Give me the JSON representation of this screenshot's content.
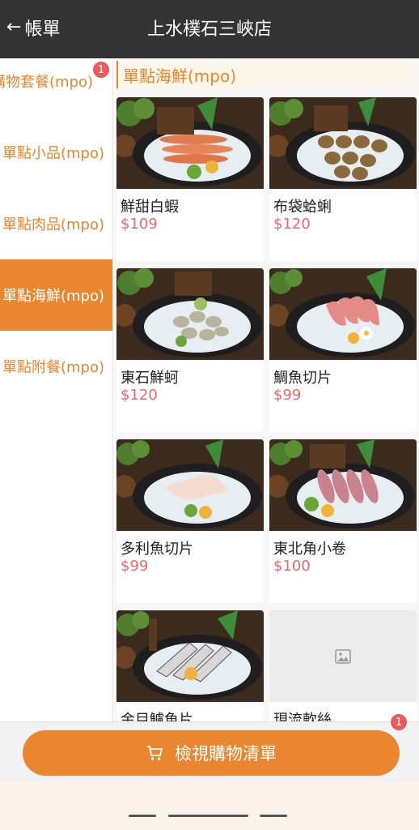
{
  "header": {
    "back_label": "帳單",
    "title": "上水樸石三峽店"
  },
  "sidebar": {
    "items": [
      {
        "label": "購物套餐(mpo)"
      },
      {
        "label": "單點小品(mpo)"
      },
      {
        "label": "單點肉品(mpo)"
      },
      {
        "label": "單點海鮮(mpo)"
      },
      {
        "label": "單點附餐(mpo)"
      }
    ],
    "active_index": 3,
    "badge_count": "1"
  },
  "section": {
    "title": "單點海鮮(mpo)"
  },
  "products": [
    {
      "name": "鮮甜白蝦",
      "price": "$109",
      "image": "shrimp-on-ice"
    },
    {
      "name": "布袋蛤蜊",
      "price": "$120",
      "image": "clams-on-ice"
    },
    {
      "name": "東石鮮蚵",
      "price": "$120",
      "image": "oysters-on-ice"
    },
    {
      "name": "鯛魚切片",
      "price": "$99",
      "image": "sea-bream-slices"
    },
    {
      "name": "多利魚切片",
      "price": "$99",
      "image": "dory-fish-slices"
    },
    {
      "name": "東北角小卷",
      "price": "$100",
      "image": "squid-on-ice"
    },
    {
      "name": "金目鱸魚片",
      "price": "",
      "image": "sea-bass-slices"
    },
    {
      "name": "現流軟絲",
      "price": "",
      "image": "image-placeholder"
    }
  ],
  "cart": {
    "label": "檢視購物清單",
    "badge_count": "1",
    "icon": "cart-icon"
  },
  "colors": {
    "accent": "#e9862f",
    "header_bg": "#333333",
    "price": "#e86a6a",
    "badge": "#e85b5b"
  }
}
